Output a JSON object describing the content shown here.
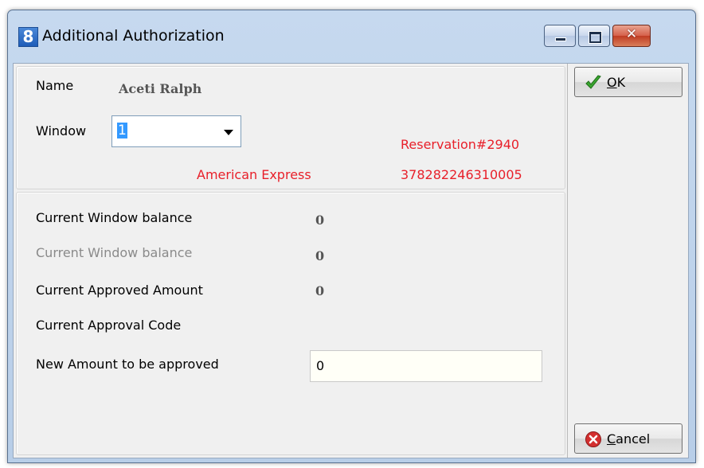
{
  "window": {
    "title": "Additional Authorization",
    "app_icon_glyph": "8",
    "controls": {
      "close_glyph": "✕"
    }
  },
  "form": {
    "name_label": "Name",
    "name_value": "Aceti  Ralph",
    "window_label": "Window",
    "window_value": "1",
    "reservation": "Reservation#2940",
    "card_type": "American Express",
    "card_number": "378282246310005",
    "rows": [
      {
        "label": "Current Window balance",
        "value": "0"
      },
      {
        "label": "Current Window balance",
        "value": "0"
      },
      {
        "label": "Current Approved Amount",
        "value": "0"
      },
      {
        "label": "Current Approval Code",
        "value": ""
      }
    ],
    "new_amount_label": "New Amount to be approved",
    "new_amount_value": "0"
  },
  "buttons": {
    "ok_mnemonic": "O",
    "ok_rest": "K",
    "cancel_mnemonic": "C",
    "cancel_rest": "ancel"
  },
  "colors": {
    "alert_red": "#e8202a",
    "ok_green": "#3aa630",
    "cancel_red": "#d32f2f"
  }
}
